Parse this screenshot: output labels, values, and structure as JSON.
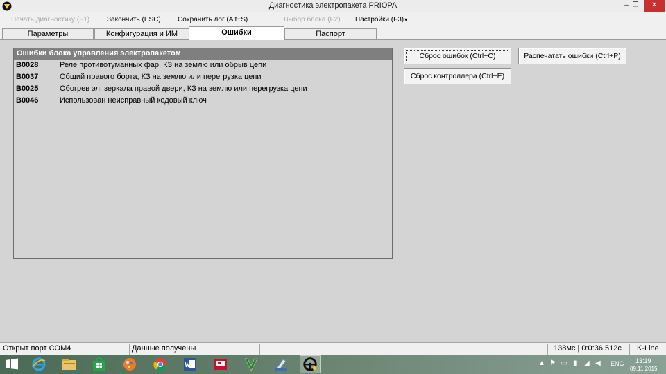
{
  "window": {
    "title": "Диагностика электропакета PRIOPA",
    "icon": "priopa-app-icon",
    "controls": {
      "minimize": "–",
      "restore": "❐",
      "close": "✕"
    }
  },
  "menu": {
    "start_diag": "Начать диагностику (F1)",
    "finish": "Закончить (ESC)",
    "save_log": "Сохранить лог (Alt+S)",
    "select_block": "Выбор блока (F2)",
    "settings": "Настройки (F3)",
    "settings_caret": "▾"
  },
  "tabs": {
    "params": "Параметры",
    "config": "Конфигурация и ИМ",
    "errors": "Ошибки",
    "passport": "Паспорт",
    "active": "errors"
  },
  "errors_panel": {
    "header": "Ошибки блока управления электропакетом",
    "rows": [
      {
        "code": "B0028",
        "desc": "Реле противотуманных фар, КЗ на землю или обрыв цепи"
      },
      {
        "code": "B0037",
        "desc": "Общий правого борта, КЗ на землю или перегрузка цепи"
      },
      {
        "code": "B0025",
        "desc": "Обогрев эл. зеркала правой двери, КЗ на землю или перегрузка цепи"
      },
      {
        "code": "B0046",
        "desc": "Использован неисправный кодовый ключ"
      }
    ]
  },
  "buttons": {
    "reset_errors": "Сброс ошибок (Ctrl+C)",
    "print_errors": "Распечатать ошибки (Ctrl+P)",
    "reset_controller": "Сброс контроллера (Ctrl+E)"
  },
  "status": {
    "port": "Открыт порт COM4",
    "data": "Данные получены",
    "timing": "138мс | 0:0:36,512c",
    "protocol": "K-Line"
  },
  "taskbar": {
    "apps": [
      "windows-start-icon",
      "internet-explorer-icon",
      "file-explorer-icon",
      "windows-store-icon",
      "paint-app-icon",
      "chrome-icon",
      "word-icon",
      "presentation-app-icon",
      "gta-v-icon",
      "tool-app-icon",
      "steering-wheel-diag-icon"
    ],
    "lang": "ENG",
    "time": "13:19",
    "date": "09.11.2015"
  },
  "colors": {
    "close_button": "#c7302f",
    "panel_header": "#7f7f7f",
    "background": "#d4d4d4"
  }
}
